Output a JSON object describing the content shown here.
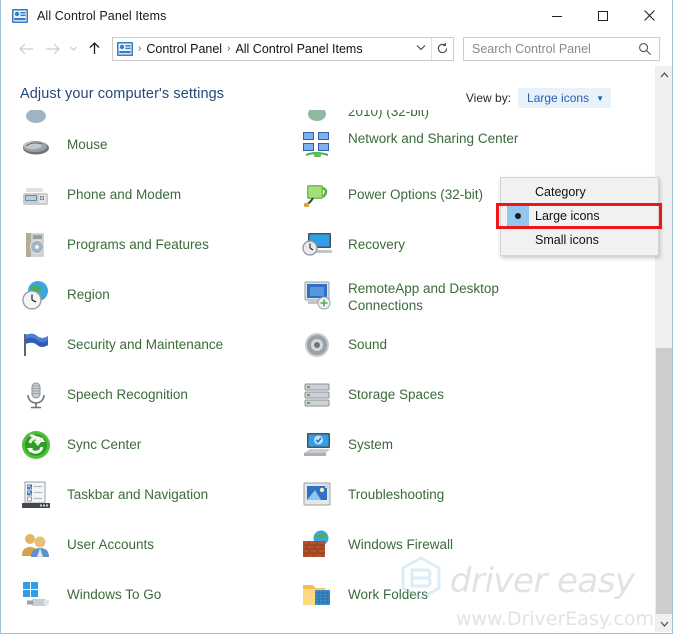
{
  "window": {
    "title": "All Control Panel Items",
    "title_icon": "control-panel-icon",
    "controls": {
      "minimize": "minimize-icon",
      "maximize": "maximize-icon",
      "close": "close-icon"
    }
  },
  "navbar": {
    "back": "back-arrow-icon",
    "forward": "forward-arrow-icon",
    "recent": "recent-locations-icon",
    "up": "up-arrow-icon",
    "breadcrumb_icon": "control-panel-icon",
    "breadcrumbs": [
      "Control Panel",
      "All Control Panel Items"
    ],
    "separator": "›",
    "dropdown_caret": "chevron-down-icon",
    "refresh": "refresh-icon",
    "search": {
      "placeholder": "Search Control Panel",
      "icon": "search-icon"
    }
  },
  "content": {
    "heading": "Adjust your computer's settings",
    "view_by": {
      "label": "View by:",
      "value": "Large icons",
      "caret": "▼"
    },
    "clipped_row_text": "2010) (32-bit)",
    "left_column": [
      {
        "label": "Mouse",
        "icon": "mouse-icon"
      },
      {
        "label": "Phone and Modem",
        "icon": "phone-modem-icon"
      },
      {
        "label": "Programs and Features",
        "icon": "programs-features-icon"
      },
      {
        "label": "Region",
        "icon": "region-icon"
      },
      {
        "label": "Security and Maintenance",
        "icon": "security-maintenance-icon"
      },
      {
        "label": "Speech Recognition",
        "icon": "microphone-icon"
      },
      {
        "label": "Sync Center",
        "icon": "sync-center-icon"
      },
      {
        "label": "Taskbar and Navigation",
        "icon": "taskbar-navigation-icon"
      },
      {
        "label": "User Accounts",
        "icon": "user-accounts-icon"
      },
      {
        "label": "Windows To Go",
        "icon": "windows-to-go-icon"
      }
    ],
    "right_column": [
      {
        "label": "Network and Sharing Center",
        "icon": "network-sharing-icon",
        "two_line": true
      },
      {
        "label": "Power Options (32-bit)",
        "icon": "power-options-icon"
      },
      {
        "label": "Recovery",
        "icon": "recovery-icon"
      },
      {
        "label": "RemoteApp and Desktop Connections",
        "icon": "remoteapp-icon",
        "two_line": true
      },
      {
        "label": "Sound",
        "icon": "sound-icon"
      },
      {
        "label": "Storage Spaces",
        "icon": "storage-spaces-icon"
      },
      {
        "label": "System",
        "icon": "system-icon"
      },
      {
        "label": "Troubleshooting",
        "icon": "troubleshooting-icon"
      },
      {
        "label": "Windows Firewall",
        "icon": "windows-firewall-icon"
      },
      {
        "label": "Work Folders",
        "icon": "work-folders-icon"
      }
    ]
  },
  "dropdown": {
    "items": [
      {
        "label": "Category",
        "selected": false
      },
      {
        "label": "Large icons",
        "selected": true
      },
      {
        "label": "Small icons",
        "selected": false
      }
    ],
    "highlight_color": "#f01616"
  },
  "scrollbar": {
    "up_arrow": "⌃",
    "down_arrow": "⌄"
  },
  "watermark": {
    "word1": "driver",
    "word2": "easy",
    "url": "www.DriverEasy.com"
  },
  "colors": {
    "item_label": "#3b6b39",
    "heading": "#23497a",
    "accent_blue": "#2b5ea8",
    "window_border": "#9ec3d8",
    "highlight_red": "#f01616"
  }
}
